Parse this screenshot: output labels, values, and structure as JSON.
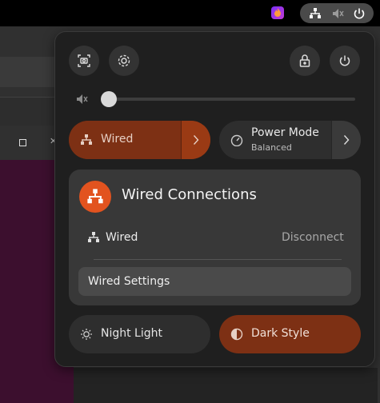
{
  "colors": {
    "accent": "#e2531f",
    "accent_dark": "#7d3014",
    "panel_bg": "#1f1f1f",
    "tile_bg": "#2e2e2e"
  },
  "topbar": {
    "app_icon": "flame-app-icon",
    "tray_icons": [
      "wired-network-icon",
      "speaker-muted-icon",
      "power-icon"
    ]
  },
  "quick_settings": {
    "buttons": {
      "screenshot": "screenshot-icon",
      "settings": "gear-icon",
      "lock": "lock-icon",
      "power": "power-icon"
    },
    "volume": {
      "icon": "speaker-muted-icon",
      "level": 0
    },
    "wired_toggle": {
      "label": "Wired",
      "icon": "wired-network-icon",
      "arrow": "chevron-right-icon"
    },
    "power_mode_toggle": {
      "label": "Power Mode",
      "subtitle": "Balanced",
      "icon": "speedometer-icon",
      "arrow": "chevron-right-icon"
    },
    "wired_menu": {
      "title": "Wired Connections",
      "icon": "wired-network-icon",
      "connection_label": "Wired",
      "disconnect_label": "Disconnect",
      "settings_label": "Wired Settings"
    },
    "night_light": {
      "label": "Night Light",
      "icon": "night-light-icon"
    },
    "dark_style": {
      "label": "Dark Style",
      "icon": "dark-style-icon"
    }
  }
}
